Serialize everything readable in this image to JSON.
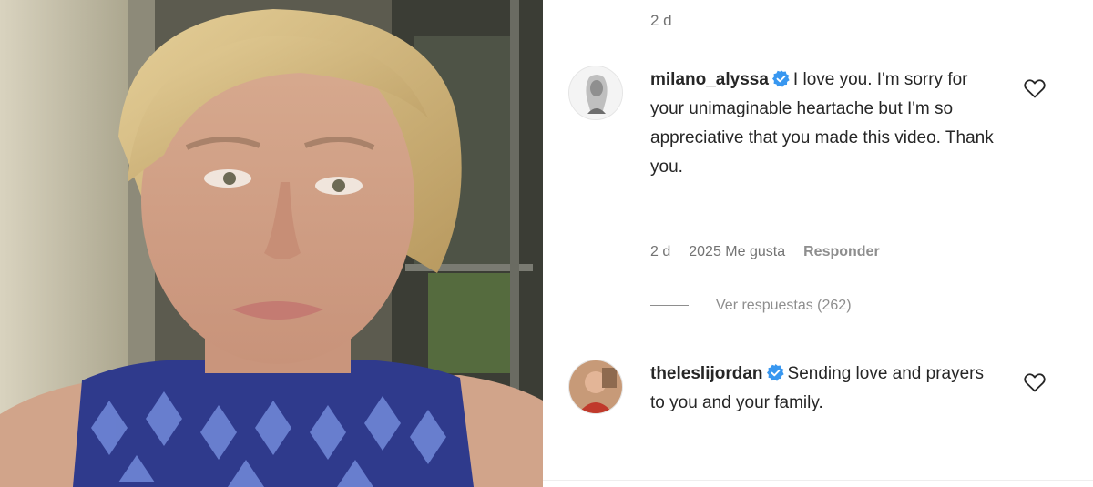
{
  "media": {
    "description_icon": "video-frame"
  },
  "panel": {
    "top_timestamp": "2 d",
    "comments": [
      {
        "username": "milano_alyssa",
        "verified": true,
        "text": "I love you. I'm sorry for your unimaginable heartache but I'm so appreciative that you made this video. Thank you.",
        "timestamp": "2 d",
        "likes": "2025 Me gusta",
        "reply_label": "Responder",
        "view_replies": "Ver respuestas (262)"
      },
      {
        "username": "theleslijordan",
        "verified": true,
        "text": "Sending love and prayers to you and your family."
      }
    ]
  },
  "icons": {
    "verified": "verified-badge-icon",
    "like": "heart-outline-icon"
  },
  "colors": {
    "verified_blue": "#3897f0",
    "secondary_text": "#737373",
    "primary_text": "#262626"
  }
}
